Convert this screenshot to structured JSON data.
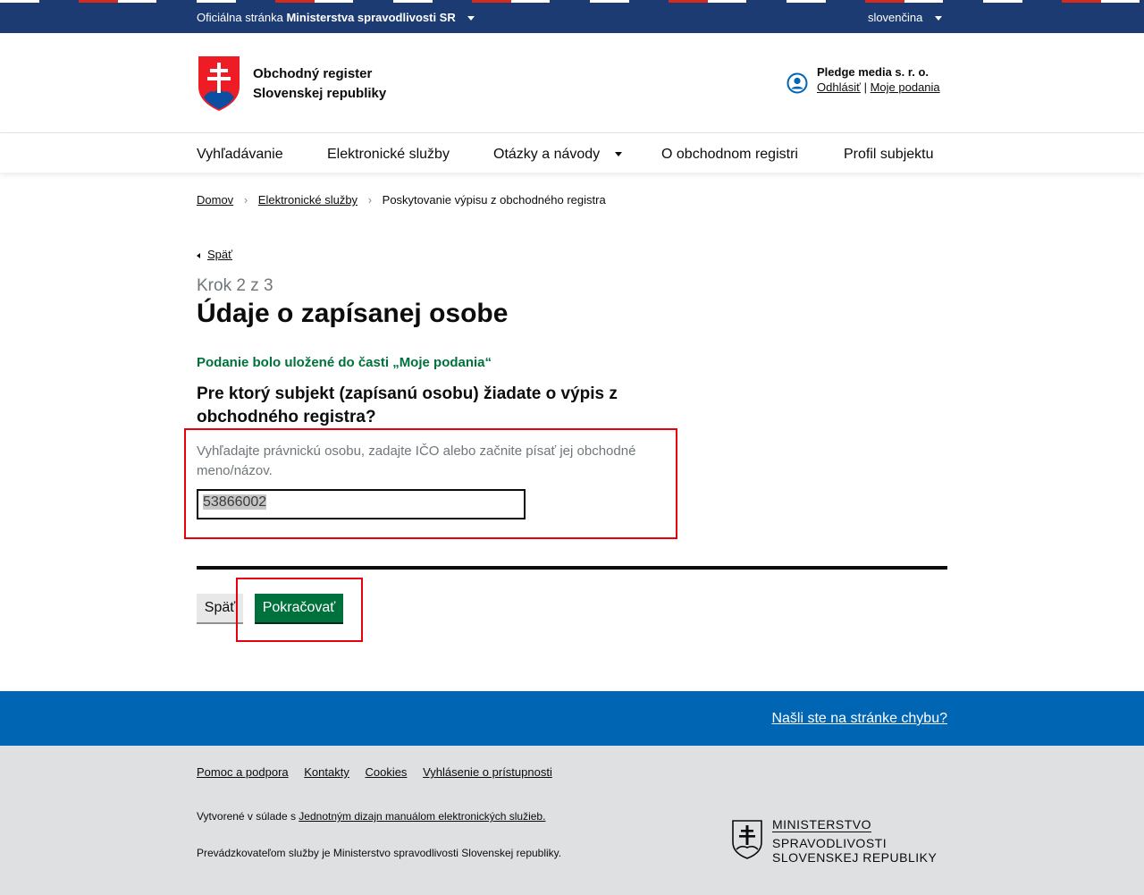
{
  "top_bar": {
    "official_prefix": "Oficiálna stránka",
    "official_ministry": "Ministerstva spravodlivosti SR",
    "language": "slovenčina"
  },
  "header": {
    "title_line1": "Obchodný register",
    "title_line2": "Slovenskej republiky",
    "user_name": "Pledge media s. r. o.",
    "logout": "Odhlásiť",
    "link_separator": "|",
    "my_submissions": "Moje podania"
  },
  "nav": {
    "items": [
      {
        "label": "Vyhľadávanie"
      },
      {
        "label": "Elektronické služby"
      },
      {
        "label": "Otázky a návody"
      },
      {
        "label": "O obchodnom registri"
      },
      {
        "label": "Profil subjektu"
      }
    ]
  },
  "breadcrumb": {
    "items": [
      "Domov",
      "Elektronické služby",
      "Poskytovanie výpisu z obchodného registra"
    ],
    "separator": "›"
  },
  "main": {
    "back_link": "Späť",
    "step": "Krok 2 z 3",
    "title": "Údaje o zapísanej osobe",
    "saved_note": "Podanie bolo uložené do časti „Moje podania“",
    "question": "Pre ktorý subjekt (zapísanú osobu) žiadate o výpis z obchodného registra?",
    "hint": "Vyhľadajte právnickú osobu, zadajte IČO alebo začnite písať jej obchodné meno/názov.",
    "search_value": "53866002",
    "back_button": "Späť",
    "continue_button": "Pokračovať"
  },
  "footer": {
    "report_bug": "Našli ste na stránke chybu?",
    "links": [
      "Pomoc a podpora",
      "Kontakty",
      "Cookies",
      "Vyhlásenie o prístupnosti"
    ],
    "created_prefix": "Vytvorené v súlade s",
    "manual_link": "Jednotným dizajn manuálom elektronických služieb.",
    "operator_text": "Prevádzkovateľom služby je Ministerstvo spravodlivosti Slovenskej republiky.",
    "ministry_line1": "MINISTERSTVO",
    "ministry_line2": "SPRAVODLIVOSTI",
    "ministry_line3": "SLOVENSKEJ REPUBLIKY"
  },
  "colors": {
    "top_bar": "#1c3b73",
    "accent_green": "#00703c",
    "footer_blue": "#0065b3",
    "footer_grey": "#dee0e2",
    "highlight_red": "#e8000d"
  },
  "icons": [
    "slovak-coat-of-arms-icon",
    "user-circle-icon",
    "chevron-down-icon",
    "chevron-left-icon",
    "breadcrumb-chevron-icon"
  ]
}
